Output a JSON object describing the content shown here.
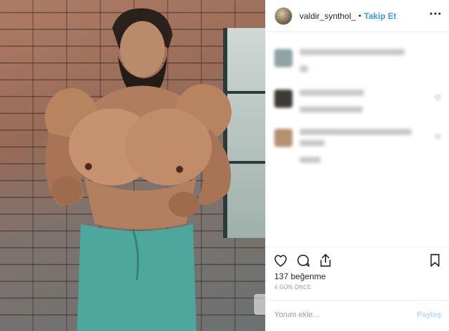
{
  "post": {
    "author": {
      "username": "valdir_synthol_",
      "separator": "•",
      "follow_label": "Takip Et",
      "avatar_icon": "profile-photo"
    },
    "photo": {
      "subject": "man flexing with oversized arms and chest",
      "icons": [
        "photo-watermark-icon"
      ]
    },
    "comments": [
      {
        "avatar_color": "#8fa2a6",
        "blurred": true
      },
      {
        "avatar_color": "#3e3a36",
        "blurred": true
      },
      {
        "avatar_color": "#b4926e",
        "blurred": true
      }
    ],
    "actions": {
      "like_icon": "heart-icon",
      "comment_icon": "comment-bubble-icon",
      "share_icon": "share-arrow-icon",
      "save_icon": "bookmark-icon"
    },
    "likes_label": "137 beğenme",
    "time_label": "4 GÜN ÖNCE",
    "comment_box": {
      "placeholder": "Yorum ekle...",
      "submit_label": "Paylaş"
    }
  },
  "colors": {
    "link_blue": "#3897f0",
    "disabled_blue": "#b3dbff",
    "muted_text": "#999999",
    "border": "#efefef"
  }
}
